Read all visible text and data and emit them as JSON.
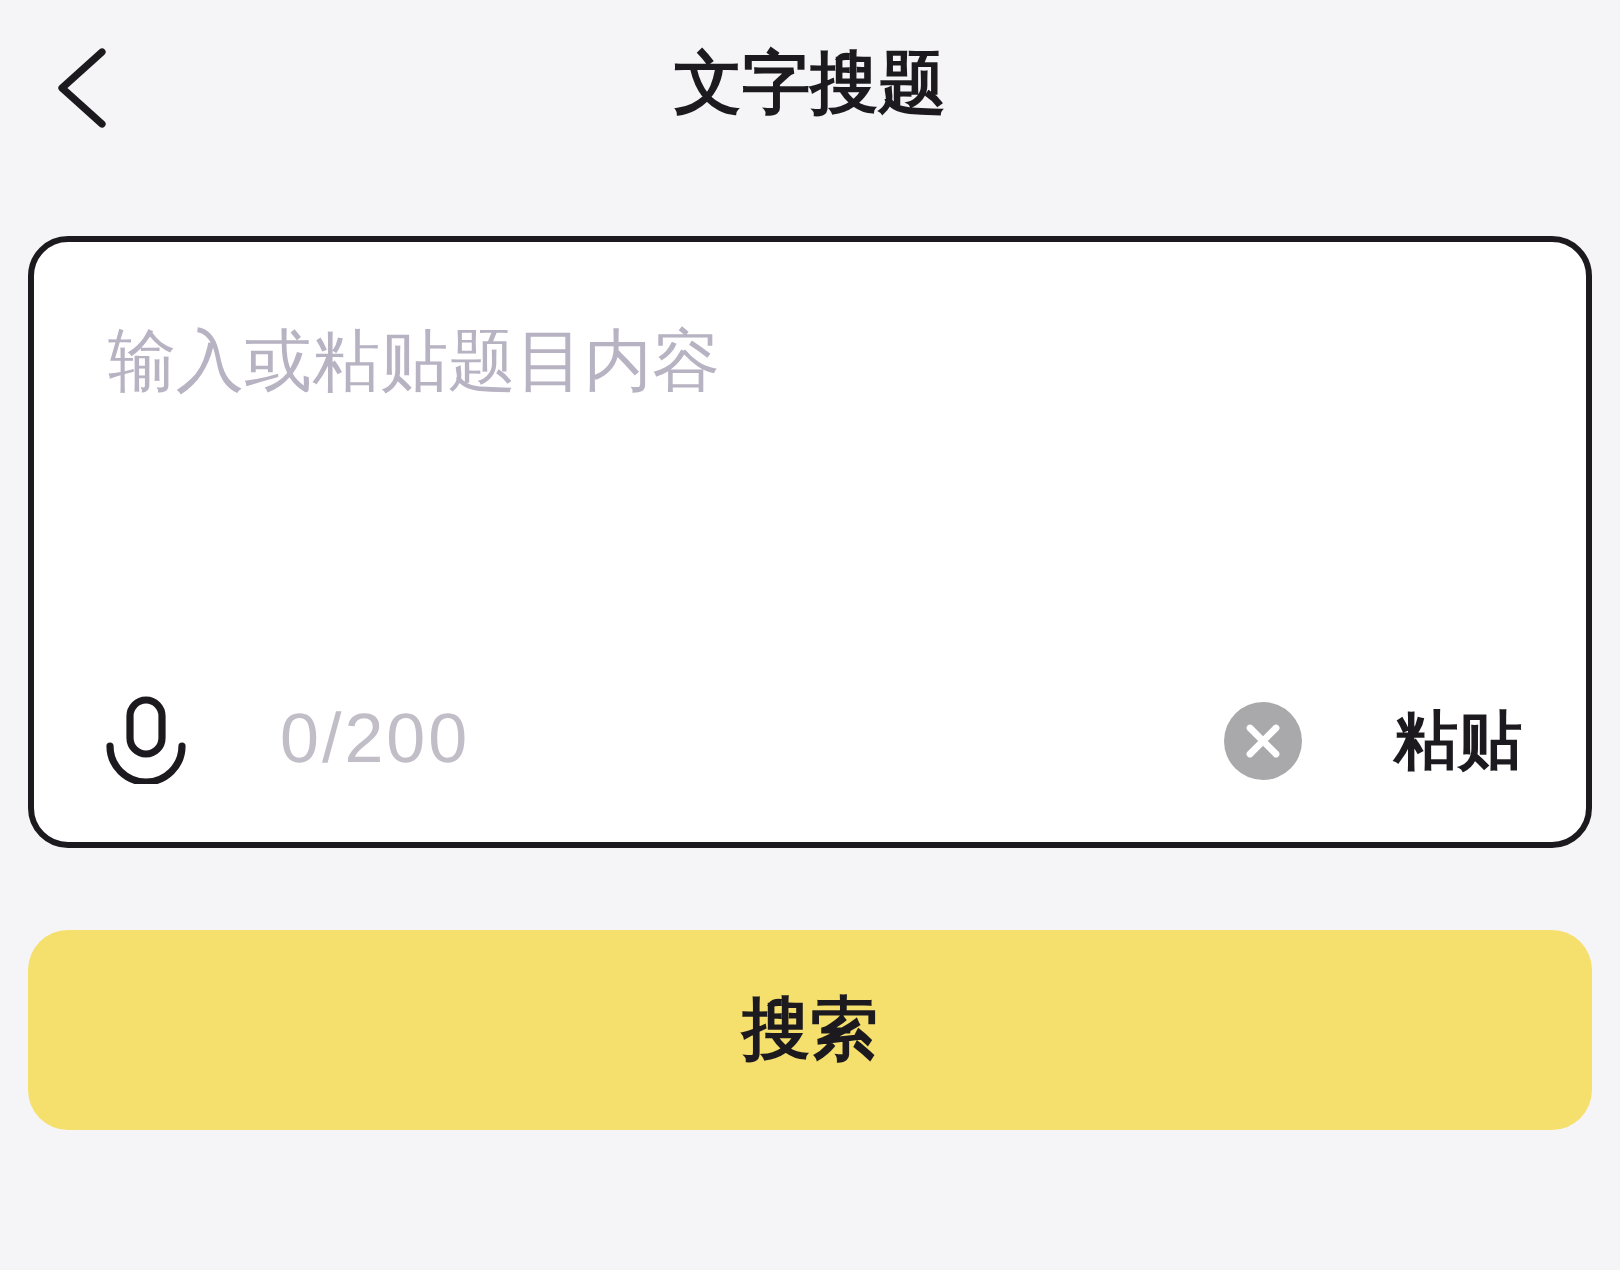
{
  "header": {
    "title": "文字搜题"
  },
  "input": {
    "placeholder": "输入或粘贴题目内容",
    "counter": "0/200",
    "paste_label": "粘贴"
  },
  "search_button": {
    "label": "搜索"
  }
}
